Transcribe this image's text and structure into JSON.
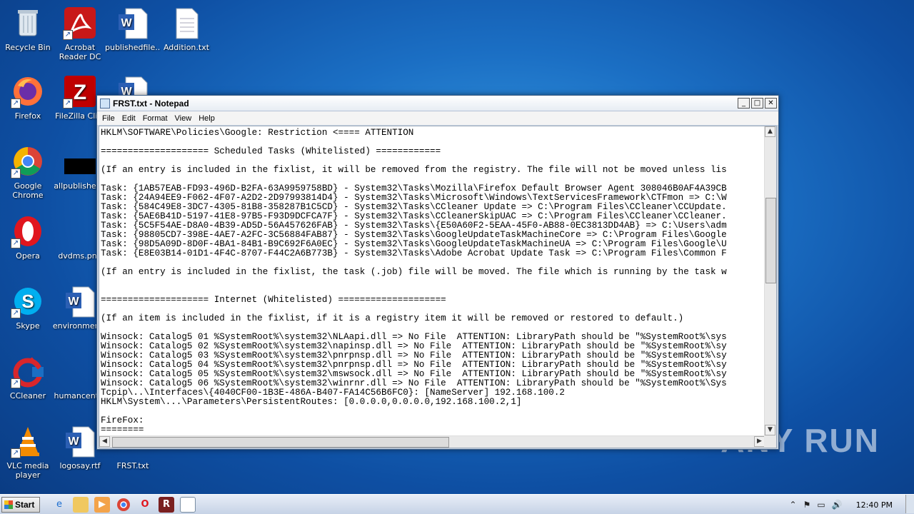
{
  "desktop": {
    "icons": [
      {
        "label": "Recycle Bin"
      },
      {
        "label": "Acrobat Reader DC"
      },
      {
        "label": "publishedfile..."
      },
      {
        "label": "Addition.txt"
      },
      {
        "label": "Firefox"
      },
      {
        "label": "FileZilla Cli..."
      },
      {
        "label": "Google Chrome"
      },
      {
        "label": "allpublisher..."
      },
      {
        "label": "Opera"
      },
      {
        "label": "dvdms.png"
      },
      {
        "label": "Skype"
      },
      {
        "label": "environmen..."
      },
      {
        "label": "CCleaner"
      },
      {
        "label": "humancent..."
      },
      {
        "label": "VLC media player"
      },
      {
        "label": "logosay.rtf"
      },
      {
        "label": "FRST.txt"
      }
    ],
    "watermark": "ANY RUN"
  },
  "notepad": {
    "title": "FRST.txt - Notepad",
    "menu": [
      "File",
      "Edit",
      "Format",
      "View",
      "Help"
    ],
    "buttons": {
      "minimize": "_",
      "maximize": "□",
      "close": "✕"
    },
    "content": "HKLM\\SOFTWARE\\Policies\\Google: Restriction <==== ATTENTION\n\n==================== Scheduled Tasks (Whitelisted) ============\n\n(If an entry is included in the fixlist, it will be removed from the registry. The file will not be moved unless lis\n\nTask: {1AB57EAB-FD93-496D-B2FA-63A9959758BD} - System32\\Tasks\\Mozilla\\Firefox Default Browser Agent 308046B0AF4A39CB\nTask: {24A94EE9-F062-4F07-A2D2-2D97993814D4} - System32\\Tasks\\Microsoft\\Windows\\TextServicesFramework\\CTFmon => C:\\W\nTask: {584C49E8-3DC7-4305-81B8-358287B1C5CD} - System32\\Tasks\\CCleaner Update => C:\\Program Files\\CCleaner\\CCUpdate.\nTask: {5AE6B41D-5197-41E8-97B5-F93D9DCFCA7F} - System32\\Tasks\\CCleanerSkipUAC => C:\\Program Files\\CCleaner\\CCleaner.\nTask: {5C5F54AE-D8A0-4B39-AD5D-56A457626FAB} - System32\\Tasks\\{E50A60F2-5EAA-45F0-AB88-0EC3813DD4AB} => C:\\Users\\adm\nTask: {98805CD7-398E-4AE7-A2FC-3C56884FAB87} - System32\\Tasks\\GoogleUpdateTaskMachineCore => C:\\Program Files\\Google\nTask: {98D5A09D-8D0F-4BA1-84B1-B9C692F6A0EC} - System32\\Tasks\\GoogleUpdateTaskMachineUA => C:\\Program Files\\Google\\U\nTask: {E8E03B14-01D1-4F4C-8707-F44C2A6B773B} - System32\\Tasks\\Adobe Acrobat Update Task => C:\\Program Files\\Common F\n\n(If an entry is included in the fixlist, the task (.job) file will be moved. The file which is running by the task w\n\n\n==================== Internet (Whitelisted) ====================\n\n(If an item is included in the fixlist, if it is a registry item it will be removed or restored to default.)\n\nWinsock: Catalog5 01 %SystemRoot%\\system32\\NLAapi.dll => No File  ATTENTION: LibraryPath should be \"%SystemRoot%\\sys\nWinsock: Catalog5 02 %SystemRoot%\\system32\\napinsp.dll => No File  ATTENTION: LibraryPath should be \"%SystemRoot%\\sy\nWinsock: Catalog5 03 %SystemRoot%\\system32\\pnrpnsp.dll => No File  ATTENTION: LibraryPath should be \"%SystemRoot%\\sy\nWinsock: Catalog5 04 %SystemRoot%\\system32\\pnrpnsp.dll => No File  ATTENTION: LibraryPath should be \"%SystemRoot%\\sy\nWinsock: Catalog5 05 %SystemRoot%\\system32\\mswsock.dll => No File  ATTENTION: LibraryPath should be \"%SystemRoot%\\sy\nWinsock: Catalog5 06 %SystemRoot%\\system32\\winrnr.dll => No File  ATTENTION: LibraryPath should be \"%SystemRoot%\\Sys\nTcpip\\..\\Interfaces\\{4040CF00-1B3E-486A-B407-FA14C56B6FC0}: [NameServer] 192.168.100.2\nHKLM\\System\\...\\Parameters\\PersistentRoutes: [0.0.0.0,0.0.0.0,192.168.100.2,1]\n\nFireFox:\n========"
  },
  "taskbar": {
    "start_label": "Start",
    "clock": "12:40 PM"
  }
}
